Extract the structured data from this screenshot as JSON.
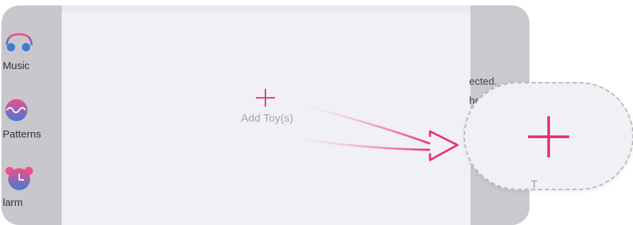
{
  "sidebar": {
    "items": [
      {
        "label": "Music",
        "icon": "headphones-icon"
      },
      {
        "label": "Patterns",
        "icon": "wave-pattern-icon"
      },
      {
        "label": "Alarm",
        "icon": "alarm-clock-icon"
      }
    ],
    "visible_labels": [
      "Music",
      "Patterns",
      "larm"
    ]
  },
  "main": {
    "add_toy_label": "Add Toy(s)",
    "add_icon": "plus-icon"
  },
  "right_text": {
    "line1": "ected.",
    "line2": "he"
  },
  "zoom": {
    "icon": "plus-icon",
    "bottom_text": "T"
  },
  "colors": {
    "accent_pink": "#e8317a",
    "icon_gradient_start": "#ef4f8a",
    "icon_gradient_end": "#3f7bd8",
    "panel_bg": "#f1f0f5",
    "frame_gray": "#c7c7cc"
  }
}
